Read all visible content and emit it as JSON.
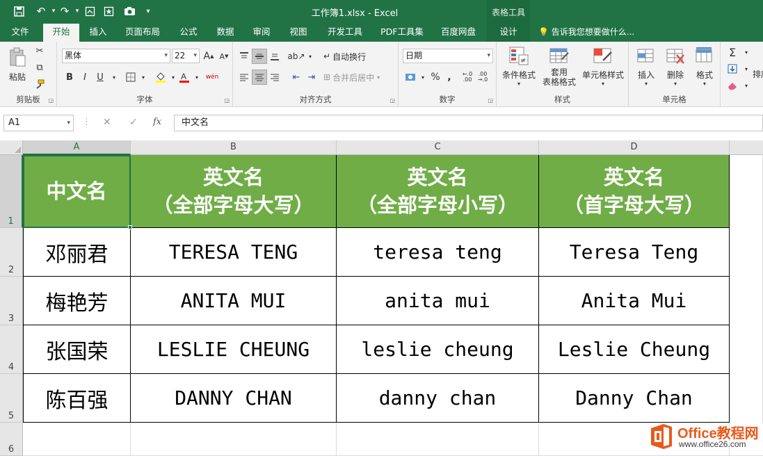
{
  "window": {
    "title": "工作簿1.xlsx - Excel",
    "context_group": "表格工具"
  },
  "tabs": [
    {
      "label": "文件"
    },
    {
      "label": "开始"
    },
    {
      "label": "插入"
    },
    {
      "label": "页面布局"
    },
    {
      "label": "公式"
    },
    {
      "label": "数据"
    },
    {
      "label": "审阅"
    },
    {
      "label": "视图"
    },
    {
      "label": "开发工具"
    },
    {
      "label": "PDF工具集"
    },
    {
      "label": "百度网盘"
    },
    {
      "label": "设计"
    }
  ],
  "active_tab": "开始",
  "tell_me": "告诉我您想要做什么...",
  "ribbon": {
    "clipboard": {
      "group": "剪贴板",
      "paste": "粘贴"
    },
    "font": {
      "group": "字体",
      "font_name": "黑体",
      "font_size": "22",
      "grow": "A",
      "shrink": "A",
      "bold": "B",
      "italic": "I",
      "underline": "U",
      "phonetic": "wén"
    },
    "alignment": {
      "group": "对齐方式",
      "wrap_text": "自动换行",
      "merge_center": "合并后居中"
    },
    "number": {
      "group": "数字",
      "format": "日期",
      "percent": "%",
      "comma": ",",
      "inc_decimal": ".00",
      "dec_decimal": ".00"
    },
    "styles": {
      "group": "样式",
      "conditional": "条件格式",
      "table_format_1": "套用",
      "table_format_2": "表格格式",
      "cell_styles": "单元格样式"
    },
    "cells": {
      "group": "单元格",
      "insert": "插入",
      "delete": "删除",
      "format": "格式"
    },
    "editing": {
      "sort": "排序"
    }
  },
  "formula_bar": {
    "name_box": "A1",
    "cancel": "✕",
    "enter": "✓",
    "fx": "fx",
    "content": "中文名"
  },
  "sheet": {
    "columns": [
      "A",
      "B",
      "C",
      "D"
    ],
    "rows": [
      "1",
      "2",
      "3",
      "4",
      "5",
      "6"
    ],
    "header": {
      "a": "中文名",
      "b1": "英文名",
      "b2": "（全部字母大写）",
      "c1": "英文名",
      "c2": "（全部字母小写）",
      "d1": "英文名",
      "d2": "（首字母大写）"
    },
    "data": [
      [
        "邓丽君",
        "TERESA TENG",
        "teresa teng",
        "Teresa Teng"
      ],
      [
        "梅艳芳",
        "ANITA MUI",
        "anita mui",
        "Anita Mui"
      ],
      [
        "张国荣",
        "LESLIE CHEUNG",
        "leslie cheung",
        "Leslie Cheung"
      ],
      [
        "陈百强",
        "DANNY CHAN",
        "danny chan",
        "Danny Chan"
      ]
    ]
  },
  "watermark": {
    "brand": "Office教程网",
    "url": "www.office26.com"
  },
  "colors": {
    "excel_green": "#217346",
    "header_fill": "#70ad47",
    "watermark_orange": "#e85a1b"
  }
}
